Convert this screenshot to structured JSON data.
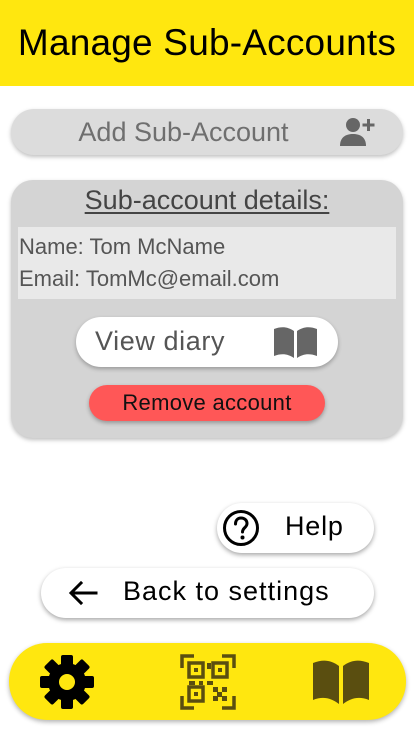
{
  "header": {
    "title": "Manage Sub-Accounts"
  },
  "add_button": {
    "label": "Add Sub-Account",
    "icon": "add-user-icon"
  },
  "card": {
    "title": "Sub-account details:",
    "name_line": "Name: Tom McName",
    "email_line": "Email: TomMc@email.com",
    "view_diary_label": "View diary",
    "view_diary_icon": "book-icon",
    "remove_label": "Remove account"
  },
  "help_button": {
    "label": "Help",
    "icon": "question-circle-icon"
  },
  "back_button": {
    "label": "Back to settings",
    "icon": "arrow-left-icon"
  },
  "bottom_nav": {
    "items": [
      {
        "icon": "gear-icon"
      },
      {
        "icon": "qr-code-icon"
      },
      {
        "icon": "book-icon"
      }
    ]
  },
  "colors": {
    "accent_yellow": "#ffe70f",
    "nav_icon": "#5a4e10",
    "card_bg": "#d4d4d4",
    "danger": "#ff5757"
  }
}
